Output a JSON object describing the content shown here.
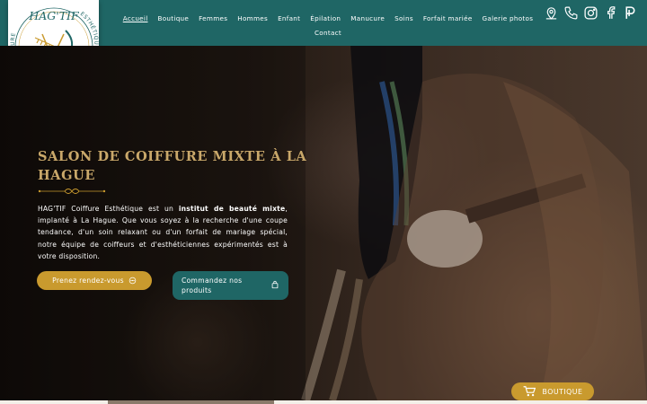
{
  "brand": {
    "name": "HAG'TIF",
    "left_text": "COIFFURE",
    "right_text": "ESTHÉTIQUE",
    "color": "#1f6665",
    "gold": "#c99a2e"
  },
  "nav": {
    "items_row1": [
      "Accueil",
      "Boutique",
      "Femmes",
      "Hommes",
      "Enfant",
      "Épilation",
      "Manucure",
      "Soins",
      "Forfait mariée",
      "Galerie photos"
    ],
    "items_row2": [
      "Contact"
    ],
    "active": "Accueil"
  },
  "socials": [
    "location-pin-icon",
    "phone-icon",
    "instagram-icon",
    "facebook-icon",
    "planity-icon"
  ],
  "hero": {
    "title": "SALON DE COIFFURE MIXTE À LA HAGUE",
    "text_before": "HAG'TIF Coiffure Esthétique est un ",
    "text_bold": "institut de beauté mixte",
    "text_after": ", implanté à La Hague. Que vous soyez à la recherche d'une coupe tendance, d'un soin relaxant ou d'un forfait de mariage spécial, notre équipe de coiffeurs et d'esthéticiennes expérimentés est à votre disposition.",
    "btn_rdv": "Prenez rendez-vous",
    "btn_cmd": "Commandez nos produits"
  },
  "floating": {
    "boutique_label": "BOUTIQUE"
  }
}
